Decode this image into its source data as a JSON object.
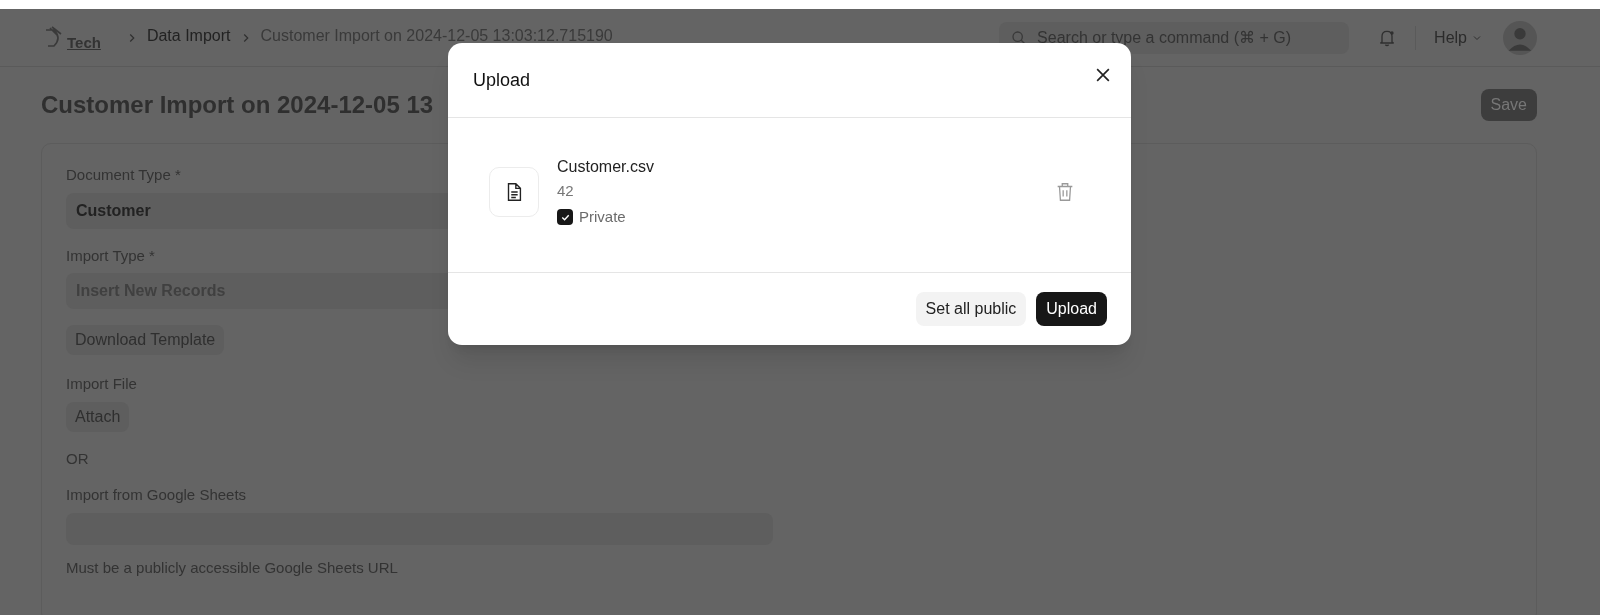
{
  "navbar": {
    "logo_text": "Tech",
    "breadcrumbs": [
      {
        "label": "Data Import",
        "current": false
      },
      {
        "label": "Customer Import on 2024-12-05 13:03:12.715190",
        "current": true
      }
    ],
    "search": {
      "placeholder": "Search or type a command (⌘ + G)"
    },
    "help": "Help"
  },
  "page": {
    "title": "Customer Import on 2024-12-05 13",
    "save_button": "Save"
  },
  "form": [
    {
      "kind": "select",
      "label": "Document Type *",
      "value": "Customer",
      "disabled": false
    },
    {
      "kind": "select",
      "label": "Import Type *",
      "value": "Insert New Records",
      "disabled": true
    },
    {
      "kind": "button",
      "label": "Download Template"
    },
    {
      "kind": "attach",
      "label": "Import File",
      "button": "Attach"
    },
    {
      "kind": "text",
      "text": "OR"
    },
    {
      "kind": "input",
      "label": "Import from Google Sheets",
      "description": "Must be a publicly accessible Google Sheets URL"
    }
  ],
  "dialog": {
    "title": "Upload",
    "files": [
      {
        "name": "Customer.csv",
        "size": "42",
        "private_label": "Private",
        "private": true
      }
    ],
    "buttons": [
      {
        "label": "Set all public",
        "primary": false
      },
      {
        "label": "Upload",
        "primary": true
      }
    ]
  }
}
